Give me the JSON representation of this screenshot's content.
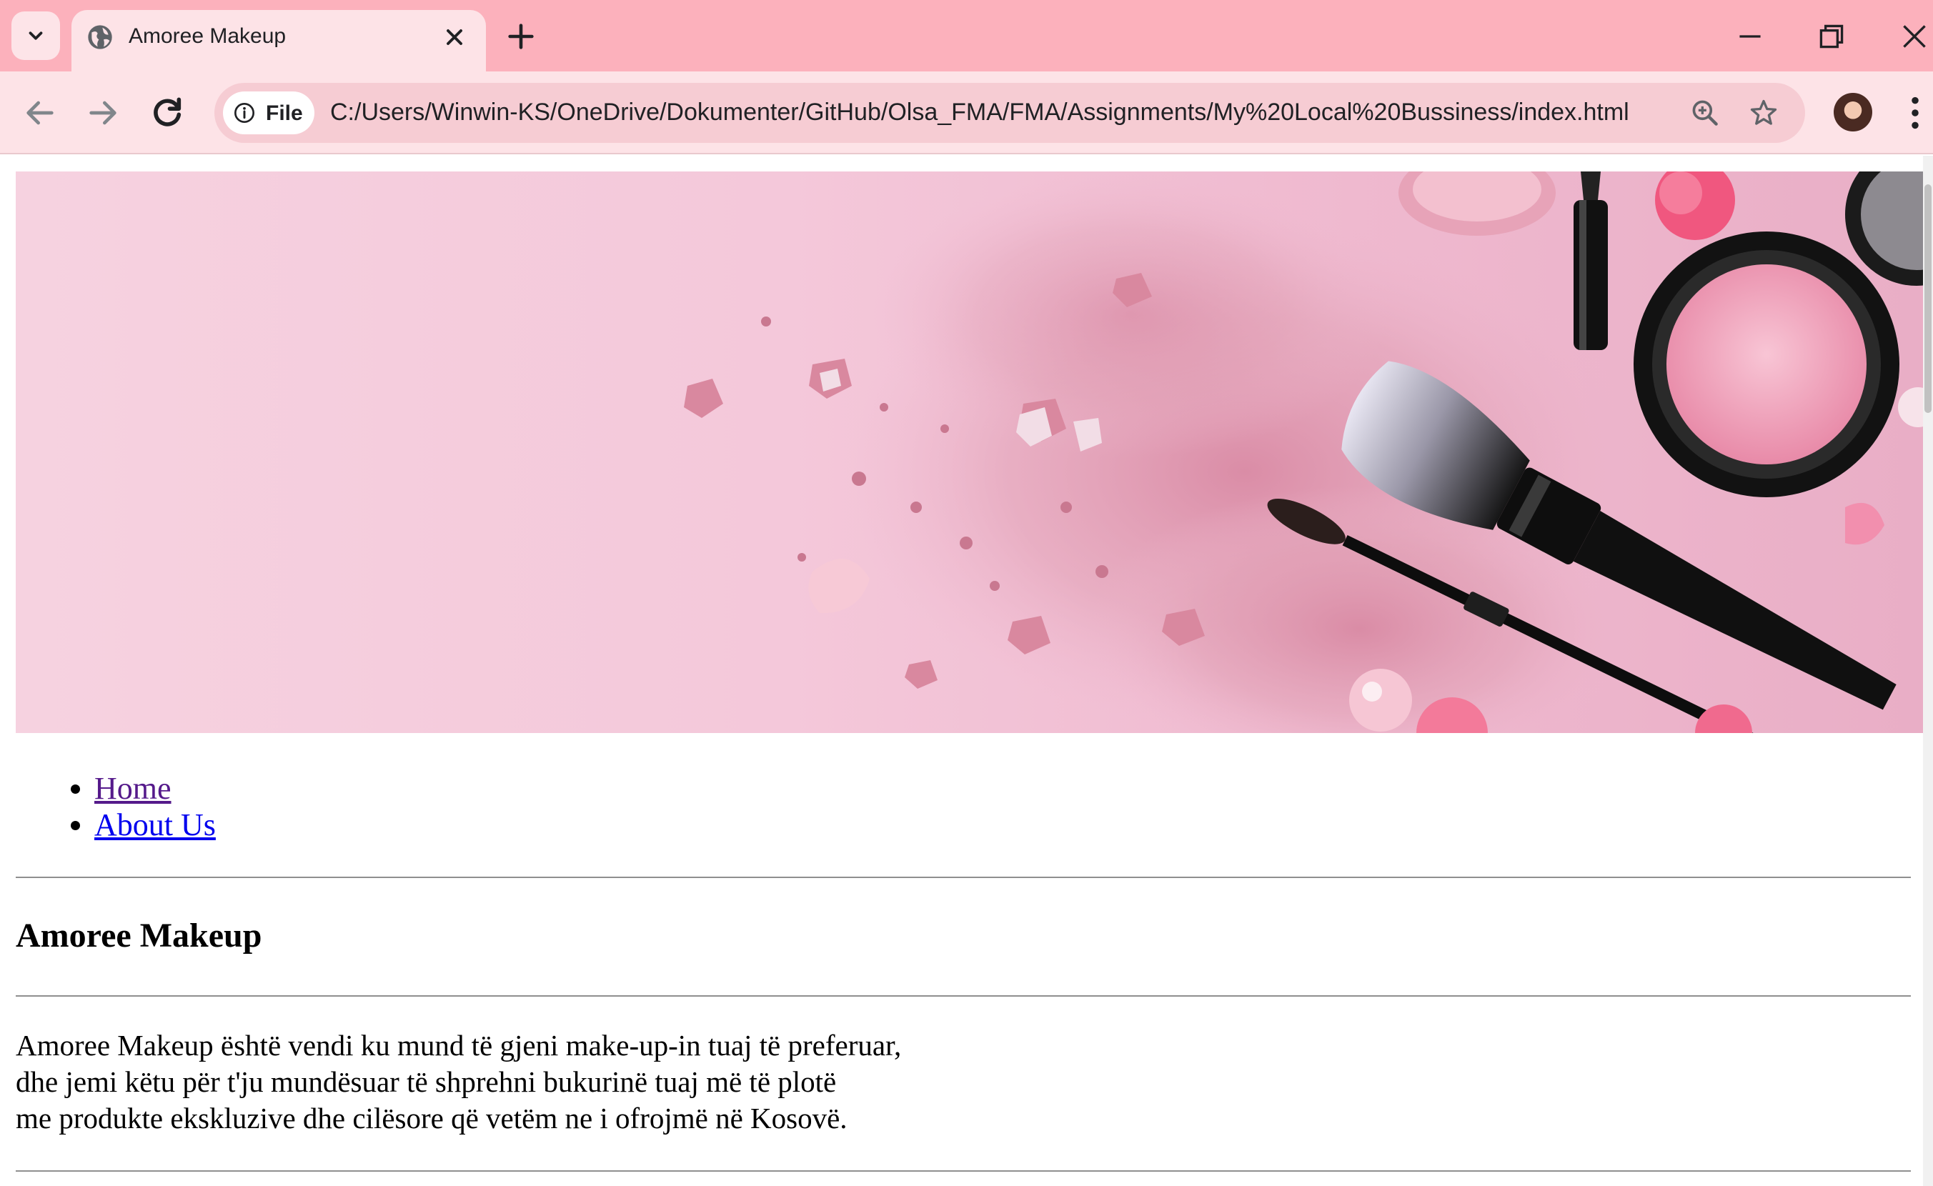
{
  "browser": {
    "tab_title": "Amoree Makeup",
    "site_info_label": "File",
    "url": "C:/Users/Winwin-KS/OneDrive/Dokumenter/GitHub/Olsa_FMA/FMA/Assignments/My%20Local%20Bussiness/index.html",
    "chrome_color": "#fcb1bc",
    "toolbar_color": "#fde3e7"
  },
  "page": {
    "banner_image": "makeup-banner",
    "nav": [
      {
        "label": "Home",
        "state": "visited"
      },
      {
        "label": "About Us",
        "state": "unvisited"
      }
    ],
    "title": "Amoree Makeup",
    "intro_lines": [
      "Amoree Makeup është vendi ku mund të gjeni make-up-in tuaj të preferuar,",
      "dhe jemi këtu për t'ju mundësuar të shprehni bukurinë tuaj më të plotë",
      "me produkte ekskluzive dhe cilësore që vetëm ne i ofrojmë në Kosovë."
    ],
    "link_color": "#0000ee",
    "visited_link_color": "#551a8b"
  }
}
